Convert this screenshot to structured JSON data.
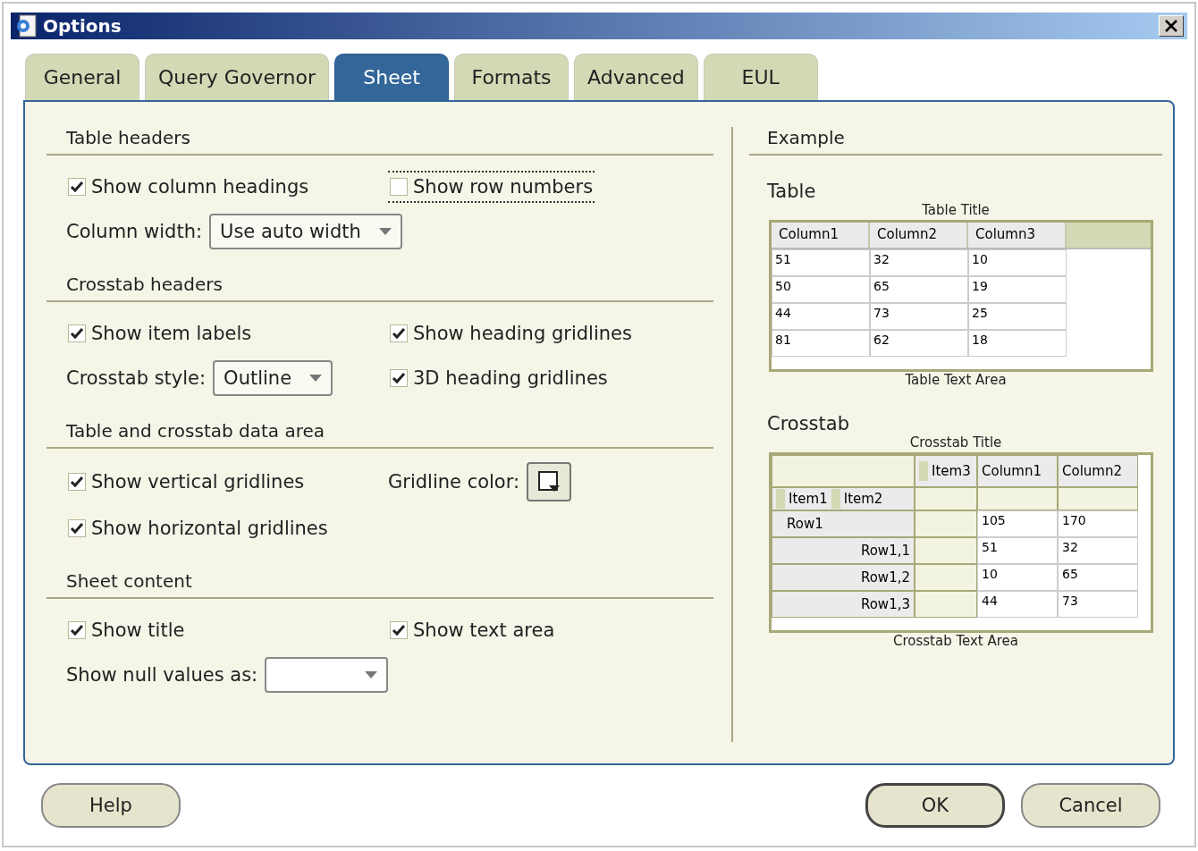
{
  "window": {
    "title": "Options"
  },
  "tabs": [
    {
      "label": "General",
      "selected": false
    },
    {
      "label": "Query Governor",
      "selected": false
    },
    {
      "label": "Sheet",
      "selected": true
    },
    {
      "label": "Formats",
      "selected": false
    },
    {
      "label": "Advanced",
      "selected": false
    },
    {
      "label": "EUL",
      "selected": false
    }
  ],
  "sections": [
    {
      "title": "Table headers",
      "rows": [
        [
          {
            "kind": "checkbox",
            "label": "Show column headings",
            "checked": true,
            "focused": false
          },
          {
            "kind": "checkbox",
            "label": "Show row numbers",
            "checked": false,
            "focused": true
          }
        ],
        [
          {
            "kind": "dropdown",
            "label": "Column width:",
            "value": "Use auto width"
          }
        ]
      ]
    },
    {
      "title": "Crosstab headers",
      "rows": [
        [
          {
            "kind": "checkbox",
            "label": "Show item labels",
            "checked": true,
            "focused": false
          },
          {
            "kind": "checkbox",
            "label": "Show heading gridlines",
            "checked": true,
            "focused": false
          }
        ],
        [
          {
            "kind": "dropdown",
            "label": "Crosstab style:",
            "value": "Outline"
          },
          {
            "kind": "checkbox",
            "label": "3D heading gridlines",
            "checked": true,
            "focused": false
          }
        ]
      ]
    },
    {
      "title": "Table and crosstab data area",
      "rows": [
        [
          {
            "kind": "checkbox",
            "label": "Show vertical gridlines",
            "checked": true,
            "focused": false
          },
          {
            "kind": "color",
            "label": "Gridline color:"
          }
        ],
        [
          {
            "kind": "checkbox",
            "label": "Show horizontal gridlines",
            "checked": true,
            "focused": false
          }
        ]
      ]
    },
    {
      "title": "Sheet content",
      "rows": [
        [
          {
            "kind": "checkbox",
            "label": "Show title",
            "checked": true,
            "focused": false
          },
          {
            "kind": "checkbox",
            "label": "Show text area",
            "checked": true,
            "focused": false
          }
        ],
        [
          {
            "kind": "dropdown",
            "label": "Show null values as:"
          }
        ]
      ]
    }
  ],
  "example": {
    "title": "Example",
    "table": {
      "heading": "Table",
      "title": "Table Title",
      "columns": [
        "Column1",
        "Column2",
        "Column3"
      ],
      "rows": [
        [
          "51",
          "32",
          "10"
        ],
        [
          "50",
          "65",
          "19"
        ],
        [
          "44",
          "73",
          "25"
        ],
        [
          "81",
          "62",
          "18"
        ]
      ],
      "text_area": "Table Text Area"
    },
    "crosstab": {
      "heading": "Crosstab",
      "title": "Crosstab Title",
      "column_item": "Item3",
      "row_items": [
        "Item1",
        "Item2"
      ],
      "columns": [
        "Column1",
        "Column2"
      ],
      "rows": [
        {
          "label": "Row1",
          "values": [
            "105",
            "170"
          ],
          "children": [
            {
              "label": "Row1,1",
              "values": [
                "51",
                "32"
              ]
            },
            {
              "label": "Row1,2",
              "values": [
                "10",
                "65"
              ]
            },
            {
              "label": "Row1,3",
              "values": [
                "44",
                "73"
              ]
            }
          ]
        }
      ],
      "text_area": "Crosstab Text Area"
    }
  },
  "buttons": [
    {
      "label": "Help",
      "default": false
    },
    {
      "label": "OK",
      "default": true
    },
    {
      "label": "Cancel",
      "default": false
    }
  ]
}
